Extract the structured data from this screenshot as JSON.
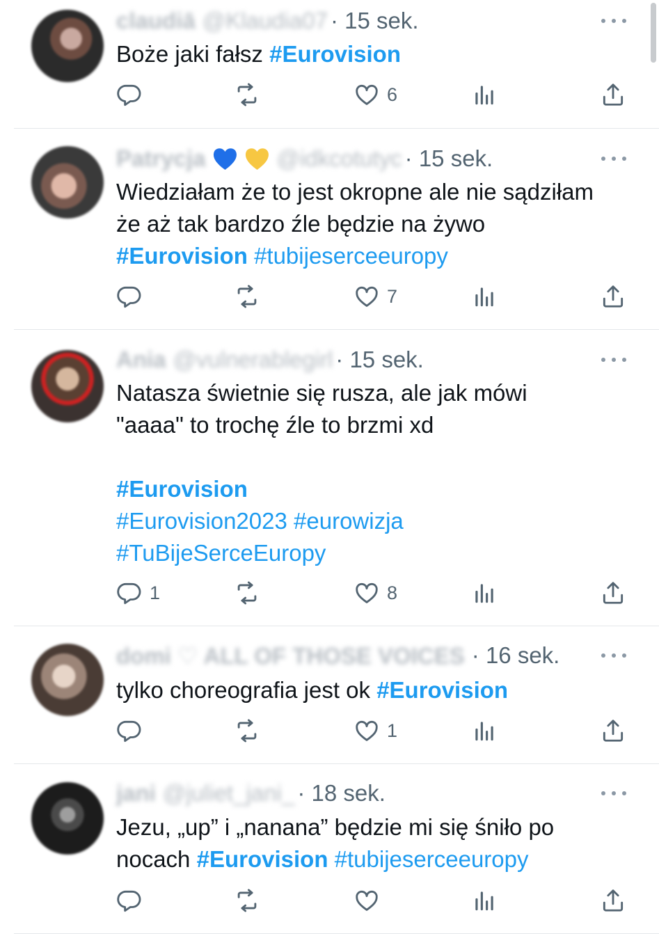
{
  "tweets": [
    {
      "name": "claudiā",
      "handle": "@Klaudia07",
      "emojis": [],
      "time": "· 15 sek.",
      "lines": [
        [
          {
            "t": "Boże jaki fałsz  ",
            "k": "plain"
          },
          {
            "t": "#Eurovision",
            "k": "tagb"
          }
        ]
      ],
      "counts": {
        "replies": "",
        "likes": "6"
      }
    },
    {
      "name": "Patrycja",
      "handle": "@idkcotutyc",
      "emojis": [
        "blue-heart",
        "yellow-heart"
      ],
      "time": "· 15 sek.",
      "lines": [
        [
          {
            "t": "Wiedziałam że to jest okropne ale nie sądziłam",
            "k": "plain"
          }
        ],
        [
          {
            "t": "że aż tak bardzo źle będzie na żywo",
            "k": "plain"
          }
        ],
        [
          {
            "t": "#Eurovision",
            "k": "tagb"
          },
          {
            "t": " ",
            "k": "plain"
          },
          {
            "t": "#tubijeserceeuropy",
            "k": "tag"
          }
        ]
      ],
      "counts": {
        "replies": "",
        "likes": "7"
      }
    },
    {
      "name": "Ania",
      "handle": "@vulnerablegirl",
      "emojis": [],
      "time": "· 15 sek.",
      "lines": [
        [
          {
            "t": "Natasza świetnie się rusza, ale jak mówi",
            "k": "plain"
          }
        ],
        [
          {
            "t": "\"aaaa\" to trochę źle to brzmi xd",
            "k": "plain"
          }
        ],
        [],
        [
          {
            "t": "#Eurovision",
            "k": "tagb"
          }
        ],
        [
          {
            "t": "#Eurovision2023",
            "k": "tag"
          },
          {
            "t": " ",
            "k": "plain"
          },
          {
            "t": "#eurowizja",
            "k": "tag"
          }
        ],
        [
          {
            "t": "#TuBijeSerceEuropy",
            "k": "tag"
          }
        ]
      ],
      "counts": {
        "replies": "1",
        "likes": "8"
      }
    },
    {
      "name": "domi ♡ ALL OF THOSE VOICES",
      "handle": "",
      "emojis": [],
      "time": "· 16 sek.",
      "lines": [
        [
          {
            "t": "tylko choreografia jest ok ",
            "k": "plain"
          },
          {
            "t": "#Eurovision",
            "k": "tagb"
          }
        ]
      ],
      "counts": {
        "replies": "",
        "likes": "1"
      }
    },
    {
      "name": "jani",
      "handle": "@juliet_jani_",
      "emojis": [],
      "time": "· 18 sek.",
      "lines": [
        [
          {
            "t": "Jezu, „up” i „nanana” będzie mi się śniło po",
            "k": "plain"
          }
        ],
        [
          {
            "t": "nocach ",
            "k": "plain"
          },
          {
            "t": "#Eurovision",
            "k": "tagb"
          },
          {
            "t": " ",
            "k": "plain"
          },
          {
            "t": "#tubijeserceeuropy",
            "k": "tag"
          }
        ]
      ],
      "counts": {
        "replies": "",
        "likes": ""
      }
    }
  ],
  "icons": {
    "reply": "reply-icon",
    "retweet": "retweet-icon",
    "like": "heart-icon",
    "views": "views-icon",
    "share": "share-icon",
    "more": "more-icon"
  },
  "colors": {
    "link": "#1d9bf0",
    "text": "#0f1419",
    "secondary": "#536471",
    "divider": "#e4e7ea"
  }
}
